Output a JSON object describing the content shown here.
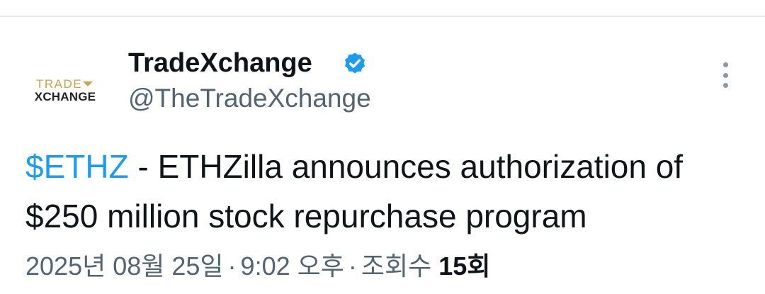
{
  "account": {
    "logo_text_top": "TRADE",
    "logo_text_bottom": "XCHANGE",
    "display_name": "TradeXchange",
    "handle": "@TheTradeXchange",
    "verified": true
  },
  "tweet": {
    "cashtag": "$ETHZ",
    "text": " - ETHZilla announces authorization of $250 million stock repurchase program"
  },
  "meta": {
    "date": "2025년 08월 25일",
    "time": "9:02 오후",
    "views_label": "조회수",
    "views_count": "15회",
    "separator": "·"
  },
  "colors": {
    "accent": "#1d9bf0",
    "secondary_text": "#536471",
    "logo_gold": "#c9a24a"
  },
  "icons": {
    "verified": "verified-badge-icon",
    "more": "more-vertical-icon"
  }
}
